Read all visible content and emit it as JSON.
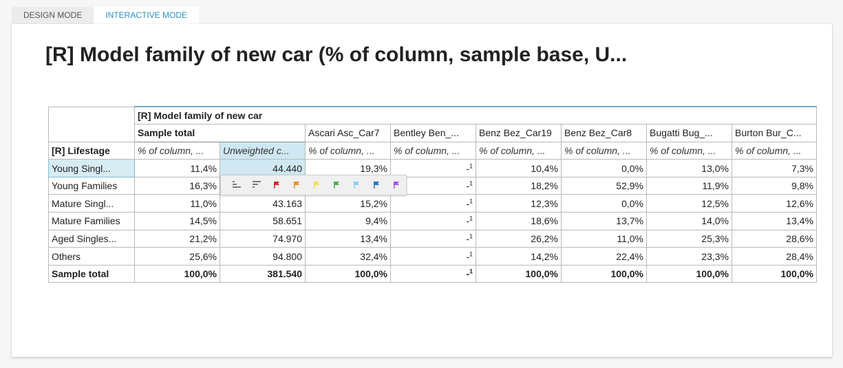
{
  "tabs": [
    {
      "label": "DESIGN MODE",
      "active": false
    },
    {
      "label": "INTERACTIVE MODE",
      "active": true
    }
  ],
  "title": "[R] Model family of new car (% of column, sample base, U...",
  "table": {
    "banner_label": "[R] Model family of new car",
    "row_var_label": "[R] Lifestage",
    "column_headers": [
      "Sample total",
      "Ascari Asc_Car7",
      "Bentley Ben_...",
      "Benz Bez_Car19",
      "Benz Bez_Car8",
      "Bugatti Bug_...",
      "Burton Bur_C..."
    ],
    "stat_headers": [
      "% of column, ...",
      "Unweighted c...",
      "% of column, ...",
      "% of column, ...",
      "% of column, ...",
      "% of column, ...",
      "% of column, ...",
      "% of column, ..."
    ],
    "rows": [
      {
        "label": "Young Singl...",
        "cells": [
          "11,4%",
          "44.440",
          "19,3%",
          "-",
          "10,4%",
          "0,0%",
          "13,0%",
          "7,3%"
        ]
      },
      {
        "label": "Young Families",
        "cells": [
          "16,3%",
          "",
          "",
          "-",
          "18,2%",
          "52,9%",
          "11,9%",
          "9,8%"
        ]
      },
      {
        "label": "Mature Singl...",
        "cells": [
          "11,0%",
          "43.163",
          "15,2%",
          "-",
          "12,3%",
          "0,0%",
          "12,5%",
          "12,6%"
        ]
      },
      {
        "label": "Mature Families",
        "cells": [
          "14,5%",
          "58.651",
          "9,4%",
          "-",
          "18,6%",
          "13,7%",
          "14,0%",
          "13,4%"
        ]
      },
      {
        "label": "Aged Singles...",
        "cells": [
          "21,2%",
          "74.970",
          "13,4%",
          "-",
          "26,2%",
          "11,0%",
          "25,3%",
          "28,6%"
        ]
      },
      {
        "label": "Others",
        "cells": [
          "25,6%",
          "94.800",
          "32,4%",
          "-",
          "14,2%",
          "22,4%",
          "23,3%",
          "28,4%"
        ]
      },
      {
        "label": "Sample total",
        "cells": [
          "100,0%",
          "381.540",
          "100,0%",
          "-",
          "100,0%",
          "100,0%",
          "100,0%",
          "100,0%"
        ]
      }
    ],
    "dash_superscript": "1"
  },
  "popup_icons": [
    {
      "name": "sort-ascending-icon",
      "color": "#7a7a7a"
    },
    {
      "name": "sort-descending-icon",
      "color": "#7a7a7a"
    },
    {
      "name": "flag-red-icon",
      "color": "#d9262c"
    },
    {
      "name": "flag-orange-icon",
      "color": "#f28b1e"
    },
    {
      "name": "flag-yellow-icon",
      "color": "#f6e04a"
    },
    {
      "name": "flag-green-icon",
      "color": "#4caf50"
    },
    {
      "name": "flag-lightblue-icon",
      "color": "#7fd3f2"
    },
    {
      "name": "flag-blue-icon",
      "color": "#1f77c9"
    },
    {
      "name": "flag-purple-icon",
      "color": "#b04fe6"
    }
  ],
  "colors": {
    "accent": "#2a8fbd",
    "selection": "#cfe8f1",
    "banner_rule": "#6aaebd"
  }
}
